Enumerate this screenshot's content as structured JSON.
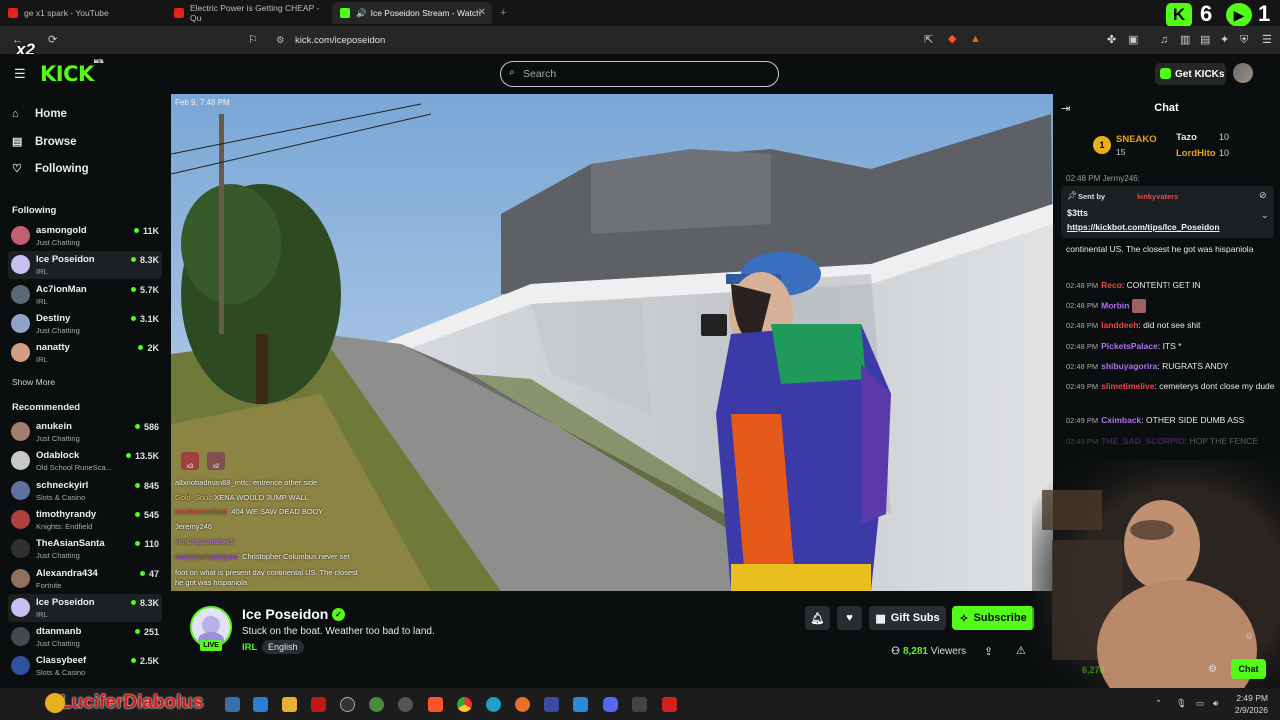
{
  "browser": {
    "tabs": [
      {
        "title": "ge x1 spark - YouTube",
        "color": "#e62117"
      },
      {
        "title": "Electric Power is Getting CHEAP - Qu",
        "color": "#e62117"
      },
      {
        "title": "Ice Poseidon Stream - Watch",
        "color": "#53fc18",
        "active": true
      }
    ],
    "url": "kick.com/iceposeidon",
    "overlay_badge": "x2",
    "overlay_counter_a": "6",
    "overlay_counter_b": "1"
  },
  "kick": {
    "logo": "KICK",
    "logo_sup": "BETA",
    "search_placeholder": "Search",
    "get_kicks": "Get KICKs"
  },
  "sidebar": {
    "nav": [
      {
        "label": "Home",
        "icon": "home-icon"
      },
      {
        "label": "Browse",
        "icon": "browse-icon"
      },
      {
        "label": "Following",
        "icon": "heart-icon"
      }
    ],
    "following_title": "Following",
    "following": [
      {
        "name": "asmongold",
        "category": "Just Chatting",
        "viewers": "11K",
        "color": "#c06070"
      },
      {
        "name": "Ice Poseidon",
        "category": "IRL",
        "viewers": "8.3K",
        "color": "#c9bff0",
        "selected": true
      },
      {
        "name": "Ac7ionMan",
        "category": "IRL",
        "viewers": "5.7K",
        "color": "#5a6878"
      },
      {
        "name": "Destiny",
        "category": "Just Chatting",
        "viewers": "3.1K",
        "color": "#8fa4c8"
      },
      {
        "name": "nanatty",
        "category": "IRL",
        "viewers": "2K",
        "color": "#d0a080"
      }
    ],
    "show_more": "Show More",
    "recommended_title": "Recommended",
    "recommended": [
      {
        "name": "anukein",
        "category": "Just Chatting",
        "viewers": "586",
        "color": "#a08070"
      },
      {
        "name": "Odablock",
        "category": "Old School RuneSca...",
        "viewers": "13.5K",
        "color": "#c8c8c8"
      },
      {
        "name": "schneckyirl",
        "category": "Slots & Casino",
        "viewers": "845",
        "color": "#6070a0"
      },
      {
        "name": "timothyrandy",
        "category": "Knights: Endfield",
        "viewers": "545",
        "color": "#b04040"
      },
      {
        "name": "TheAsianSanta",
        "category": "Just Chatting",
        "viewers": "110",
        "color": "#303030"
      },
      {
        "name": "Alexandra434",
        "category": "Fortnite",
        "viewers": "47",
        "color": "#907060"
      },
      {
        "name": "Ice Poseidon",
        "category": "IRL",
        "viewers": "8.3K",
        "color": "#c9bff0",
        "selected": true
      },
      {
        "name": "dtanmanb",
        "category": "Just Chatting",
        "viewers": "251",
        "color": "#404850"
      },
      {
        "name": "Classybeef",
        "category": "Slots & Casino",
        "viewers": "2.5K",
        "color": "#3050a0"
      }
    ]
  },
  "video": {
    "timestamp": "Feb 9, 7:48 PM",
    "overlay_badges": [
      "x3",
      "x2"
    ],
    "overlay_chat": [
      {
        "user": "albinobadman88_mtfc",
        "text": "entrence other side",
        "color": "#f0f0f0"
      },
      {
        "user": "Gold_Soul",
        "text": "XENA WOULD JUMP WALL",
        "color": "#e8c048"
      },
      {
        "user": "mushroomdead",
        "text": "404 WE SAW DEAD BODY",
        "color": "#e84848"
      },
      {
        "user": "Jeremy246",
        "text": "",
        "color": "#f0f0f0"
      },
      {
        "user": "HotChipSandwich",
        "text": "",
        "color": "#c070f0"
      },
      {
        "user": "murrymurryumyum",
        "text": "Christopher Columbus never set",
        "color": "#a050e0"
      }
    ],
    "overlay_chat_cont": [
      "foot on what is present day continental US. The closest",
      "he got was hispaniola"
    ]
  },
  "stream": {
    "name": "Ice Poseidon",
    "title": "Stuck on the boat. Weather too bad to land.",
    "category": "IRL",
    "tag": "English",
    "live": "LIVE",
    "gift_subs": "Gift Subs",
    "subscribe": "Subscribe",
    "viewers": "8,281",
    "viewers_label": "Viewers"
  },
  "chat": {
    "title": "Chat",
    "leaders": [
      {
        "rank": "1",
        "name": "SNEAKO",
        "value": "15"
      },
      {
        "name": "Tazo",
        "value": "10"
      },
      {
        "name": "LordHito",
        "value": "10"
      }
    ],
    "pinned": {
      "sent_by": "Sent by",
      "user": "kinkyvaters",
      "amount": "$3tts",
      "link": "https://kickbot.com/tips/Ice_Poseidon"
    },
    "partial_top": "02:48 PM Jermy246: ",
    "messages": [
      {
        "time": "",
        "user": "",
        "text": "continental US. The closest he got was hispaniola",
        "color": "#e8e8e8"
      },
      {
        "time": "02:48 PM",
        "user": "Reco",
        "text": "CONTENT! GET IN",
        "color": "#e84848"
      },
      {
        "time": "02:48 PM",
        "user": "Morbin",
        "text": "",
        "color": "#b070f0"
      },
      {
        "time": "02:48 PM",
        "user": "landdeeh",
        "text": "did not see shit",
        "color": "#e84848"
      },
      {
        "time": "02:48 PM",
        "user": "PicketsPalace",
        "text": "ITS *",
        "color": "#b070f0"
      },
      {
        "time": "02:48 PM",
        "user": "shibuyagorira",
        "text": "RUGRATS ANDY",
        "color": "#b070f0"
      },
      {
        "time": "02:49 PM",
        "user": "slimetimelive",
        "text": "cemeterys dont close my dude",
        "color": "#e84848"
      },
      {
        "time": "02:49 PM",
        "user": "Cximback",
        "text": "OTHER SIDE DUMB ASS",
        "color": "#b070f0"
      },
      {
        "time": "02:49 PM",
        "user": "THE_SAD_SCORPIO",
        "text": "HOP THE FENCE",
        "color": "#a050e0"
      }
    ],
    "chat_button": "Chat",
    "faded_count": "6,270"
  },
  "taskbar": {
    "user_overlay": "LuciferDiabolus",
    "time": "2:49 PM",
    "date": "2/9/2026"
  }
}
